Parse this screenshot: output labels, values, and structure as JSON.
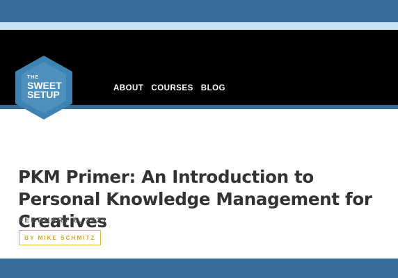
{
  "brand": {
    "line1": "THE",
    "line2": "SWEET",
    "line3": "SETUP",
    "colors": {
      "hex_outer": "#3d83b3",
      "hex_inner": "#5b9bc7"
    }
  },
  "nav": {
    "items": [
      {
        "label": "ABOUT"
      },
      {
        "label": "COURSES"
      },
      {
        "label": "BLOG"
      }
    ]
  },
  "article": {
    "title": "PKM Primer: An Introduction to Personal Knowledge Management for Creatives",
    "date": "FEBRUARY 8, 2021",
    "byline": "BY MIKE SCHMITZ"
  },
  "colors": {
    "band": "#3a6c99",
    "light_band": "#c9e2f1",
    "header": "#000000",
    "title_text": "#333333",
    "accent": "#e0b53f"
  }
}
